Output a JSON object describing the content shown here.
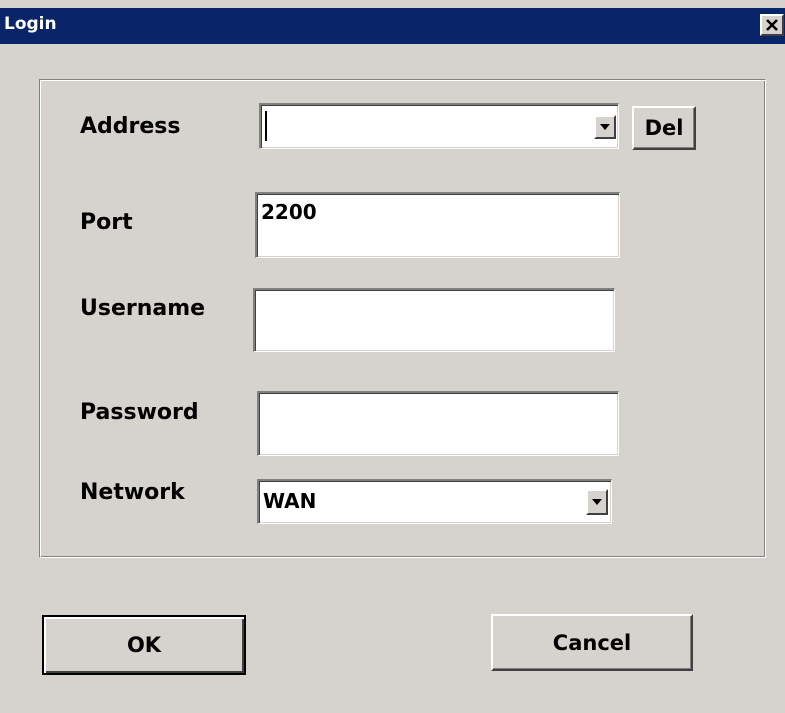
{
  "window": {
    "title": "Login"
  },
  "form": {
    "address": {
      "label": "Address",
      "value": ""
    },
    "del_label": "Del",
    "port": {
      "label": "Port",
      "value": "2200"
    },
    "username": {
      "label": "Username",
      "value": ""
    },
    "password": {
      "label": "Password",
      "value": ""
    },
    "network": {
      "label": "Network",
      "value": "WAN"
    }
  },
  "buttons": {
    "ok": "OK",
    "cancel": "Cancel"
  },
  "icons": {
    "close": "close-icon",
    "dropdown": "chevron-down-icon"
  }
}
